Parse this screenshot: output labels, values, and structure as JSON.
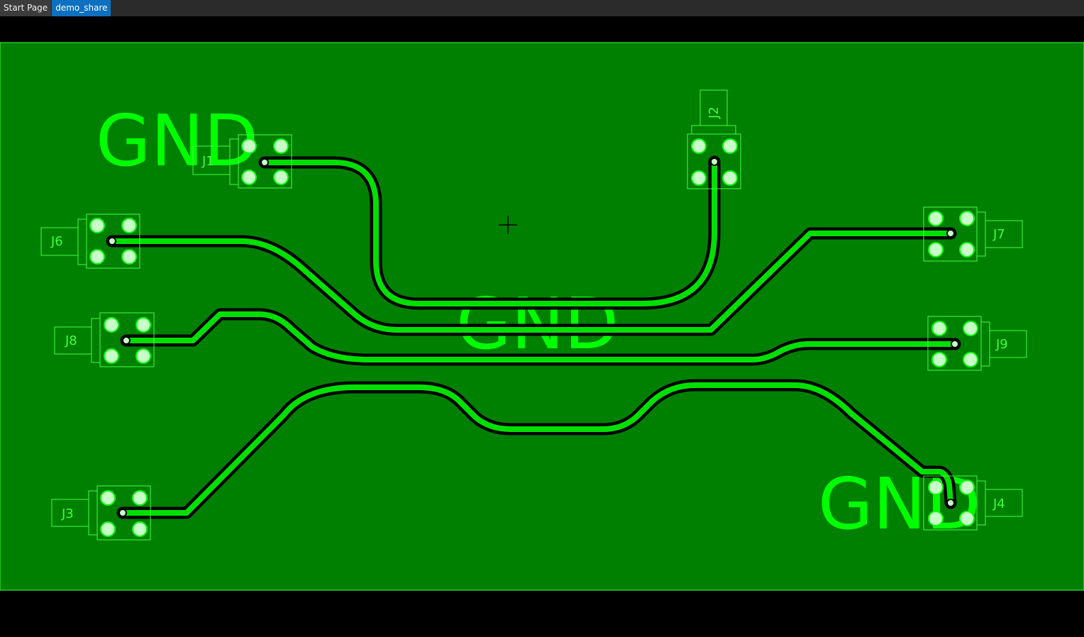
{
  "tabs": [
    {
      "label": "Start Page",
      "active": false
    },
    {
      "label": "demo_share",
      "active": true
    }
  ],
  "colors": {
    "board": "#008000",
    "copper": "#00e000",
    "silkscreen": "#40ff40",
    "gnd_text": "#00ff00",
    "clearance": "#000000",
    "pad": "#c8ffc8"
  },
  "board": {
    "gnd_labels": [
      "GND",
      "GND",
      "GND"
    ],
    "connectors": [
      {
        "ref": "J1"
      },
      {
        "ref": "J2"
      },
      {
        "ref": "J3"
      },
      {
        "ref": "J4"
      },
      {
        "ref": "J6"
      },
      {
        "ref": "J7"
      },
      {
        "ref": "J8"
      },
      {
        "ref": "J9"
      }
    ],
    "cursor_icon": "crosshair-icon"
  }
}
